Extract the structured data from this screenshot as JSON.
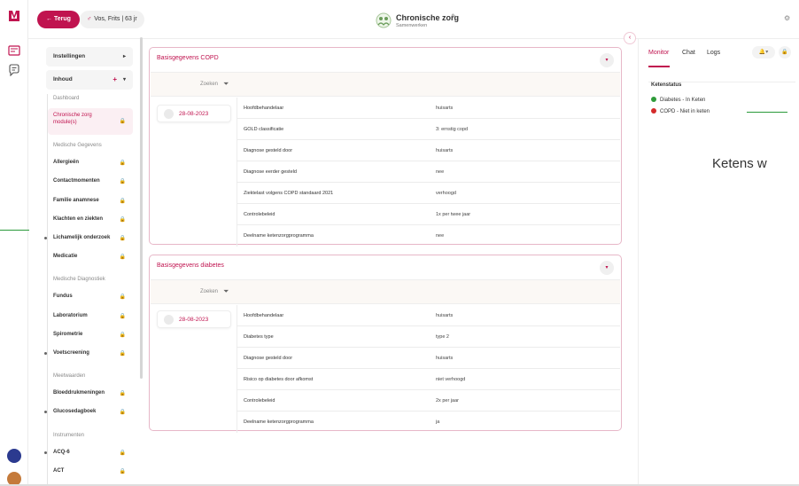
{
  "header": {
    "back_label": "Terug",
    "patient_label": "Vos, Frits | 63 jr",
    "title": "Chronische zorg",
    "subtitle": "Samenwerken"
  },
  "sidebar": {
    "instellingen": "Instellingen",
    "inhoud": "Inhoud",
    "groups": [
      {
        "title": "Dashboard",
        "items": [
          {
            "label": "Chronische zorg module(s)",
            "active": true
          }
        ]
      },
      {
        "title": "Medische Gegevens",
        "items": [
          {
            "label": "Allergieën"
          },
          {
            "label": "Contactmomenten"
          },
          {
            "label": "Familie anamnese"
          },
          {
            "label": "Klachten en ziekten"
          },
          {
            "label": "Lichamelijk onderzoek"
          },
          {
            "label": "Medicatie"
          }
        ]
      },
      {
        "title": "Medische Diagnostiek",
        "items": [
          {
            "label": "Fundus"
          },
          {
            "label": "Laboratorium"
          },
          {
            "label": "Spirometrie"
          },
          {
            "label": "Voetscreening"
          }
        ]
      },
      {
        "title": "Meetwaarden",
        "items": [
          {
            "label": "Bloeddrukmeningen"
          },
          {
            "label": "Glucosedagboek"
          }
        ]
      },
      {
        "title": "Instrumenten",
        "items": [
          {
            "label": "ACQ-6"
          },
          {
            "label": "ACT"
          }
        ]
      }
    ]
  },
  "cards": [
    {
      "title": "Basisgegevens COPD",
      "search_label": "Zoeken",
      "date": "28-08-2023",
      "rows": [
        {
          "k": "Hoofdbehandelaar",
          "v": "huisarts"
        },
        {
          "k": "GOLD classificatie",
          "v": "3: ernstig copd"
        },
        {
          "k": "Diagnose gesteld door",
          "v": "huisarts"
        },
        {
          "k": "Diagnose eerder gesteld",
          "v": "nee"
        },
        {
          "k": "Ziektelast volgens COPD standaard 2021",
          "v": "verhoogd"
        },
        {
          "k": "Controlebeleid",
          "v": "1x per twee jaar"
        },
        {
          "k": "Deelname ketenzorgprogramma",
          "v": "nee"
        }
      ]
    },
    {
      "title": "Basisgegevens diabetes",
      "search_label": "Zoeken",
      "date": "28-08-2023",
      "rows": [
        {
          "k": "Hoofdbehandelaar",
          "v": "huisarts"
        },
        {
          "k": "Diabetes type",
          "v": "type 2"
        },
        {
          "k": "Diagnose gesteld door",
          "v": "huisarts"
        },
        {
          "k": "Risico op diabetes door afkomst",
          "v": "niet verhoogd"
        },
        {
          "k": "Controlebeleid",
          "v": "2x per jaar"
        },
        {
          "k": "Deelname ketenzorgprogramma",
          "v": "ja"
        }
      ]
    }
  ],
  "right_panel": {
    "tabs": [
      "Monitor",
      "Chat",
      "Logs"
    ],
    "active_tab": "Monitor",
    "ketenstatus_title": "Ketenstatus",
    "items": [
      {
        "label": "Diabetes - In Keten",
        "color": "#2e9b3a"
      },
      {
        "label": "COPD - Niet in keten",
        "color": "#d42b2b"
      }
    ]
  },
  "annotation": "Ketens w",
  "colors": {
    "accent": "#c0134f",
    "card_border": "#e7b7c8",
    "green": "#2e9b3a",
    "red": "#d42b2b"
  }
}
